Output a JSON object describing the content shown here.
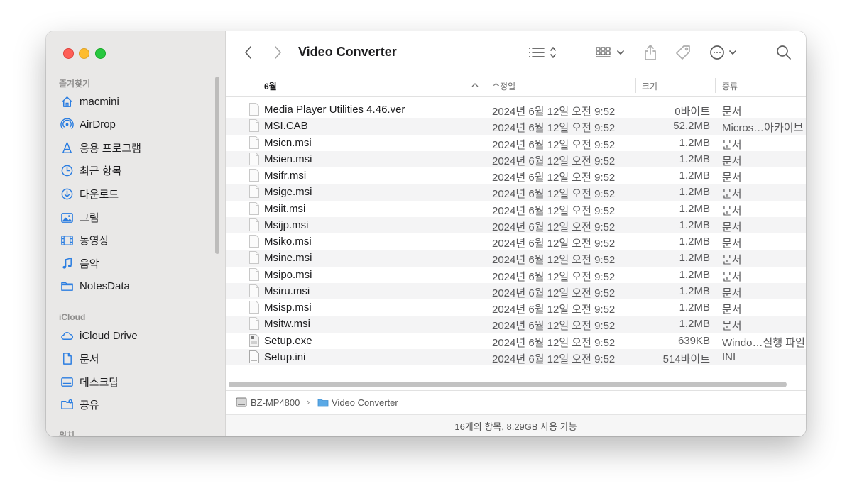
{
  "window": {
    "title": "Video Converter"
  },
  "sidebar": {
    "favorites_header": "즐겨찾기",
    "favorites": [
      {
        "label": "macmini",
        "icon": "home-icon"
      },
      {
        "label": "AirDrop",
        "icon": "airdrop-icon"
      },
      {
        "label": "응용 프로그램",
        "icon": "applications-icon"
      },
      {
        "label": "최근 항목",
        "icon": "clock-icon"
      },
      {
        "label": "다운로드",
        "icon": "download-icon"
      },
      {
        "label": "그림",
        "icon": "picture-icon"
      },
      {
        "label": "동영상",
        "icon": "film-icon"
      },
      {
        "label": "음악",
        "icon": "music-icon"
      },
      {
        "label": "NotesData",
        "icon": "folder-icon"
      }
    ],
    "icloud_header": "iCloud",
    "icloud": [
      {
        "label": "iCloud Drive",
        "icon": "cloud-icon"
      },
      {
        "label": "문서",
        "icon": "document-icon"
      },
      {
        "label": "데스크탑",
        "icon": "desktop-icon"
      },
      {
        "label": "공유",
        "icon": "shared-folder-icon"
      }
    ],
    "locations_header": "위치"
  },
  "columns": {
    "name": "6월",
    "date": "수정일",
    "size": "크기",
    "kind": "종류"
  },
  "files": [
    {
      "name": "Media Player Utilities 4.46.ver",
      "date": "2024년 6월 12일 오전 9:52",
      "size": "0바이트",
      "kind": "문서"
    },
    {
      "name": "MSI.CAB",
      "date": "2024년 6월 12일 오전 9:52",
      "size": "52.2MB",
      "kind": "Micros…아카이브"
    },
    {
      "name": "Msicn.msi",
      "date": "2024년 6월 12일 오전 9:52",
      "size": "1.2MB",
      "kind": "문서"
    },
    {
      "name": "Msien.msi",
      "date": "2024년 6월 12일 오전 9:52",
      "size": "1.2MB",
      "kind": "문서"
    },
    {
      "name": "Msifr.msi",
      "date": "2024년 6월 12일 오전 9:52",
      "size": "1.2MB",
      "kind": "문서"
    },
    {
      "name": "Msige.msi",
      "date": "2024년 6월 12일 오전 9:52",
      "size": "1.2MB",
      "kind": "문서"
    },
    {
      "name": "Msiit.msi",
      "date": "2024년 6월 12일 오전 9:52",
      "size": "1.2MB",
      "kind": "문서"
    },
    {
      "name": "Msijp.msi",
      "date": "2024년 6월 12일 오전 9:52",
      "size": "1.2MB",
      "kind": "문서"
    },
    {
      "name": "Msiko.msi",
      "date": "2024년 6월 12일 오전 9:52",
      "size": "1.2MB",
      "kind": "문서"
    },
    {
      "name": "Msine.msi",
      "date": "2024년 6월 12일 오전 9:52",
      "size": "1.2MB",
      "kind": "문서"
    },
    {
      "name": "Msipo.msi",
      "date": "2024년 6월 12일 오전 9:52",
      "size": "1.2MB",
      "kind": "문서"
    },
    {
      "name": "Msiru.msi",
      "date": "2024년 6월 12일 오전 9:52",
      "size": "1.2MB",
      "kind": "문서"
    },
    {
      "name": "Msisp.msi",
      "date": "2024년 6월 12일 오전 9:52",
      "size": "1.2MB",
      "kind": "문서"
    },
    {
      "name": "Msitw.msi",
      "date": "2024년 6월 12일 오전 9:52",
      "size": "1.2MB",
      "kind": "문서"
    },
    {
      "name": "Setup.exe",
      "date": "2024년 6월 12일 오전 9:52",
      "size": "639KB",
      "kind": "Windo…실행 파일",
      "icon": "exe"
    },
    {
      "name": "Setup.ini",
      "date": "2024년 6월 12일 오전 9:52",
      "size": "514바이트",
      "kind": "INI",
      "icon": "ini"
    }
  ],
  "pathbar": {
    "drive": "BZ-MP4800",
    "folder": "Video Converter"
  },
  "status": "16개의 항목, 8.29GB 사용 가능"
}
